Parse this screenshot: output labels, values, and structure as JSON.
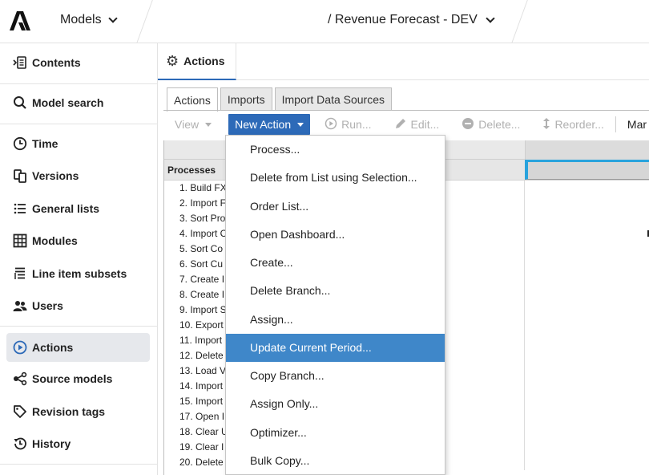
{
  "topbar": {
    "models_label": "Models",
    "model_title": "/ Revenue Forecast - DEV"
  },
  "sidebar": {
    "items": [
      {
        "label": "Contents",
        "icon": "contents-icon"
      },
      {
        "label": "Model search",
        "icon": "search-icon"
      },
      {
        "label": "Time",
        "icon": "clock-icon"
      },
      {
        "label": "Versions",
        "icon": "versions-icon"
      },
      {
        "label": "General lists",
        "icon": "list-icon"
      },
      {
        "label": "Modules",
        "icon": "grid-icon"
      },
      {
        "label": "Line item subsets",
        "icon": "subsets-icon"
      },
      {
        "label": "Users",
        "icon": "users-icon"
      },
      {
        "label": "Actions",
        "icon": "play-icon",
        "active": true
      },
      {
        "label": "Source models",
        "icon": "share-icon"
      },
      {
        "label": "Revision tags",
        "icon": "tag-icon"
      },
      {
        "label": "History",
        "icon": "history-icon"
      }
    ]
  },
  "main": {
    "tab_label": "Actions",
    "subtabs": [
      "Actions",
      "Imports",
      "Import Data Sources"
    ],
    "toolbar": {
      "view": "View",
      "new_action": "New Action",
      "run": "Run...",
      "edit": "Edit...",
      "delete": "Delete...",
      "reorder": "Reorder...",
      "manage": "Mar"
    },
    "grid": {
      "processes_label": "Processes",
      "rows": [
        "1. Build FX",
        "2. Import F",
        "3. Sort Pro",
        "4. Import C",
        "5. Sort Co",
        "6. Sort Cu",
        "7. Create I",
        "8. Create I",
        "9. Import S",
        "10. Export",
        "11. Import",
        "12. Delete",
        "13. Load V",
        "14. Import",
        "15. Import",
        "17. Open I",
        "18. Clear U",
        "19. Clear I",
        "20. Delete"
      ]
    }
  },
  "dropdown": {
    "items": [
      "Process...",
      "Delete from List using Selection...",
      "Order List...",
      "Open Dashboard...",
      "Create...",
      "Delete Branch...",
      "Assign...",
      "Update Current Period...",
      "Copy Branch...",
      "Assign Only...",
      "Optimizer...",
      "Bulk Copy..."
    ],
    "highlighted_index": 7
  },
  "colors": {
    "accent": "#2d6ab8",
    "menu_highlight": "#3f87c9",
    "selection_bar": "#29a3dd"
  }
}
